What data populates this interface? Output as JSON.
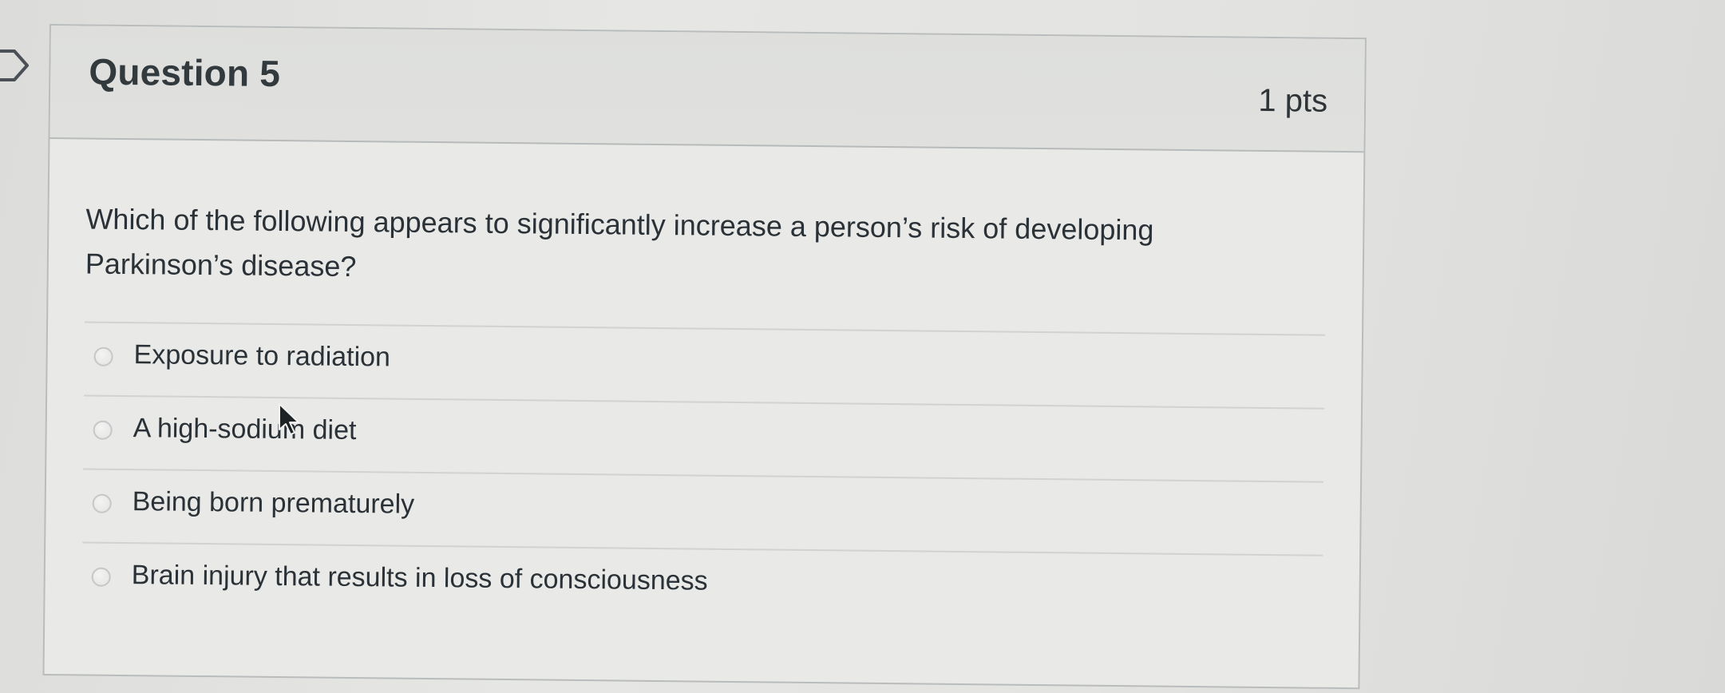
{
  "question": {
    "title": "Question 5",
    "points": "1 pts",
    "text": "Which of the following appears to significantly increase a person’s risk of developing Parkinson’s disease?"
  },
  "answers": [
    {
      "label": "Exposure to radiation"
    },
    {
      "label": "A high-sodium diet"
    },
    {
      "label": "Being born prematurely"
    },
    {
      "label": "Brain injury that results in loss of consciousness"
    }
  ],
  "colors": {
    "background": "#e3e3e1",
    "header": "#dedfdd",
    "border": "#b9bcbd",
    "text": "#2b3237"
  },
  "icons": {
    "flag": "question-flag-icon",
    "radio": "radio-button-icon",
    "cursor": "mouse-pointer-icon"
  }
}
